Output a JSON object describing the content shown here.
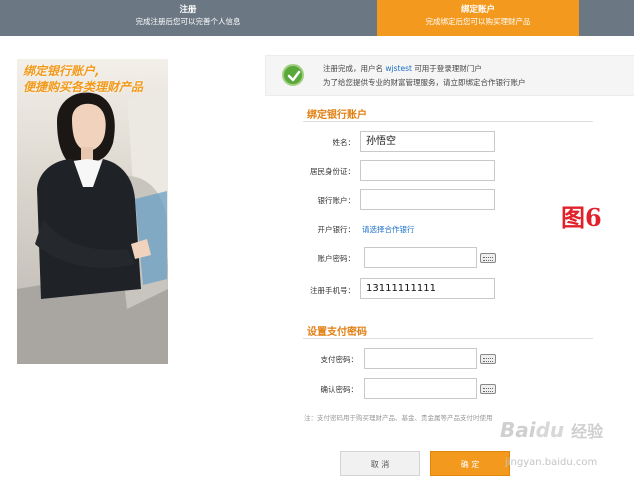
{
  "steps": [
    {
      "title": "注册",
      "subtitle": "完成注册后您可以完善个人信息"
    },
    {
      "title": "绑定账户",
      "subtitle": "完成绑定后您可以购买理财产品"
    }
  ],
  "promo": {
    "line1": "绑定银行账户,",
    "line2": "便捷购买各类理财产品"
  },
  "banner": {
    "line1_prefix": "注册完成，用户名",
    "username": "wjstest",
    "line1_suffix": "可用于登录理财门户",
    "line2": "为了给您提供专业的财富管理服务，请立即绑定合作银行账户"
  },
  "bind_section": {
    "title": "绑定银行账户",
    "name_label": "姓名：",
    "name_value": "孙悟空",
    "id_label": "居民身份证：",
    "account_label": "银行账户：",
    "bank_label": "开户银行：",
    "bank_link": "请选择合作银行",
    "acct_pwd_label": "账户密码：",
    "phone_label": "注册手机号：",
    "phone_value": "13111111111"
  },
  "pay_section": {
    "title": "设置支付密码",
    "pay_pwd_label": "支付密码：",
    "confirm_label": "确认密码：",
    "note": "注：支付密码用于购买理财产品、基金、贵金属等产品支付时使用"
  },
  "figure_label": "图6",
  "buttons": {
    "cancel": "取 消",
    "confirm": "确 定"
  },
  "watermark": {
    "brand": "Bai",
    "suffix": "经验",
    "url": "jingyan.baidu.com"
  },
  "colors": {
    "accent": "#f39a1e",
    "step_bar": "#6b7884",
    "link": "#1a6fc9",
    "success": "#5aa73a"
  }
}
